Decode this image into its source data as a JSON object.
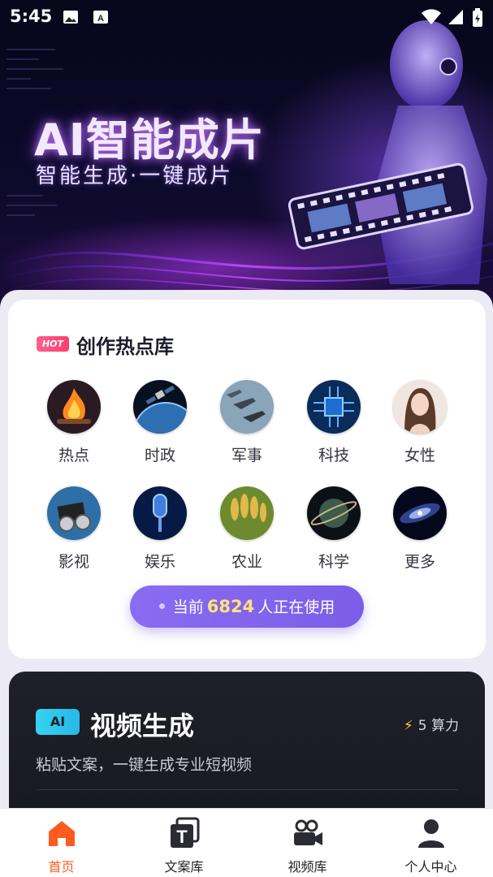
{
  "status_bar": {
    "time": "5:45"
  },
  "hero": {
    "title": "AI智能成片",
    "subtitle": "智能生成·一键成片"
  },
  "hot_section": {
    "badge": "HOT",
    "title": "创作热点库",
    "categories": [
      {
        "label": "热点",
        "icon": "bonfire-icon"
      },
      {
        "label": "时政",
        "icon": "satellite-earth-icon"
      },
      {
        "label": "军事",
        "icon": "fighter-jets-icon"
      },
      {
        "label": "科技",
        "icon": "chip-icon"
      },
      {
        "label": "女性",
        "icon": "woman-portrait-icon"
      },
      {
        "label": "影视",
        "icon": "film-clapper-icon"
      },
      {
        "label": "娱乐",
        "icon": "microphone-icon"
      },
      {
        "label": "农业",
        "icon": "wheat-icon"
      },
      {
        "label": "科学",
        "icon": "planet-icon"
      },
      {
        "label": "更多",
        "icon": "galaxy-icon"
      }
    ],
    "usage": {
      "prefix": "当前",
      "count": "6824",
      "suffix": "人正在使用"
    }
  },
  "video_card": {
    "badge": "AI",
    "title": "视频生成",
    "cost": "5 算力",
    "description": "粘贴文案，一键生成专业短视频"
  },
  "bottom_nav": {
    "items": [
      {
        "label": "首页",
        "icon": "home-icon",
        "active": true
      },
      {
        "label": "文案库",
        "icon": "text-library-icon",
        "active": false
      },
      {
        "label": "视频库",
        "icon": "video-camera-icon",
        "active": false
      },
      {
        "label": "个人中心",
        "icon": "user-icon",
        "active": false
      }
    ]
  },
  "colors": {
    "accent": "#ff5a1f",
    "pill": "#8a6cf2",
    "hot_badge": "#ff3e6c",
    "ai_badge": "#35d3f0"
  }
}
